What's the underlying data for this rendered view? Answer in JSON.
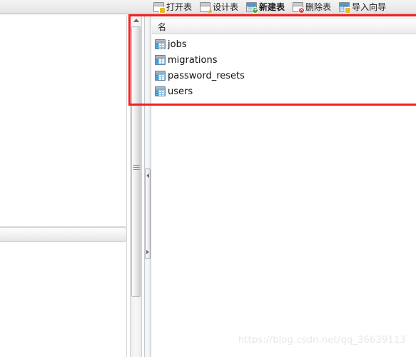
{
  "toolbar": {
    "buttons": [
      {
        "label": "打开表",
        "icon": "open-table-icon",
        "badge": "none",
        "active": false
      },
      {
        "label": "设计表",
        "icon": "design-table-icon",
        "badge": "pencil",
        "active": false
      },
      {
        "label": "新建表",
        "icon": "new-table-icon",
        "badge": "green",
        "active": true
      },
      {
        "label": "删除表",
        "icon": "delete-table-icon",
        "badge": "red",
        "active": false
      },
      {
        "label": "导入向导",
        "icon": "import-wizard-icon",
        "badge": "yellow",
        "active": false
      }
    ]
  },
  "object_list": {
    "column_header": "名",
    "row_icon": "table-icon",
    "rows": [
      {
        "name": "jobs"
      },
      {
        "name": "migrations"
      },
      {
        "name": "password_resets"
      },
      {
        "name": "users"
      }
    ]
  },
  "scrollbar": {
    "up_arrow_icon": "triangle-up-icon",
    "grip_icon": "grip-lines-icon"
  },
  "splitter": {
    "collapse_left_icon": "triangle-left-icon",
    "collapse_right_icon": "triangle-right-icon"
  },
  "annotation": {
    "shape": "rectangle",
    "color": "#f42020"
  },
  "watermark": {
    "text": "https://blog.csdn.net/qq_36639113"
  }
}
